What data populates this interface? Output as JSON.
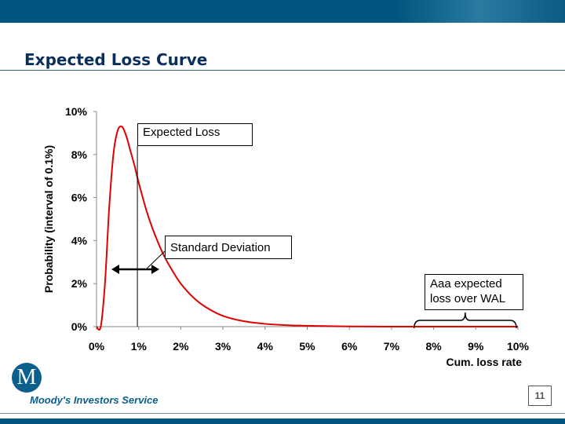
{
  "slide": {
    "title": "Expected Loss Curve",
    "brand": "Moody's Investors Service",
    "logo": "M",
    "page_number": "11",
    "accent": "#00567f"
  },
  "chart_data": {
    "type": "line",
    "xlabel": "Cum. loss rate",
    "ylabel": "Probability (interval of 0.1%)",
    "xlim": [
      0,
      10
    ],
    "ylim": [
      0,
      10
    ],
    "xticks": [
      "0%",
      "1%",
      "2%",
      "3%",
      "4%",
      "5%",
      "6%",
      "7%",
      "8%",
      "9%",
      "10%"
    ],
    "yticks": [
      "0%",
      "2%",
      "4%",
      "6%",
      "8%",
      "10%"
    ],
    "grid": false,
    "series": [
      {
        "color": "#e00000",
        "x": [
          0,
          0.1,
          0.2,
          0.3,
          0.4,
          0.5,
          0.6,
          0.7,
          0.8,
          0.9,
          1.0,
          1.2,
          1.4,
          1.6,
          1.8,
          2.0,
          2.3,
          2.6,
          3.0,
          3.5,
          4.0,
          4.5,
          5.0,
          6.0,
          7.0,
          8.0,
          9.0,
          10.0
        ],
        "y": [
          0,
          0,
          2.0,
          5.5,
          8.0,
          9.1,
          9.3,
          8.9,
          8.2,
          7.5,
          6.7,
          5.3,
          4.2,
          3.3,
          2.6,
          2.0,
          1.35,
          0.9,
          0.5,
          0.25,
          0.13,
          0.07,
          0.04,
          0.01,
          0,
          0,
          0,
          0
        ]
      }
    ],
    "annotations": {
      "expected_loss": "Expected Loss",
      "expected_loss_x": 0.97,
      "std_dev": "Standard Deviation",
      "aaa": "Aaa expected loss over WAL",
      "aaa_range": [
        7.5,
        10
      ]
    }
  }
}
